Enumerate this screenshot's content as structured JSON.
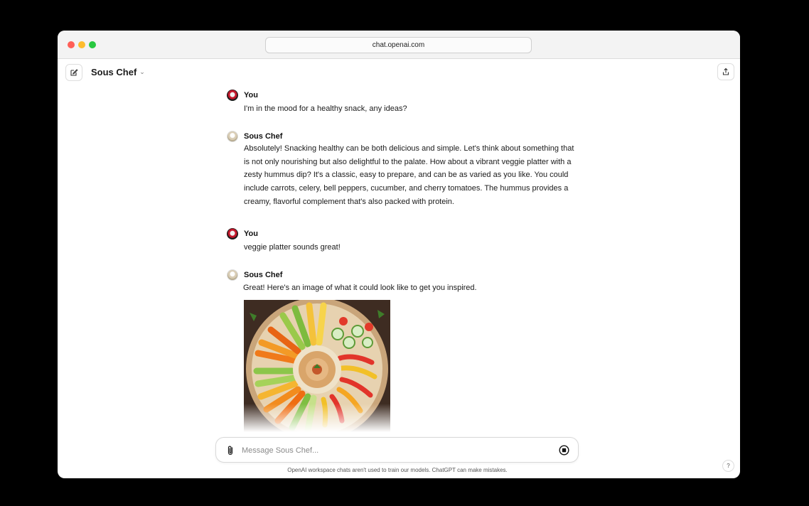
{
  "browser": {
    "url": "chat.openai.com"
  },
  "header": {
    "model_name": "Sous Chef"
  },
  "messages": [
    {
      "author": "You",
      "text": "I'm in the mood for a healthy snack, any ideas?"
    },
    {
      "author": "Sous Chef",
      "text": "Absolutely! Snacking healthy can be both delicious and simple. Let's think about something that is not only nourishing but also delightful to the palate. How about a vibrant veggie platter with a zesty hummus dip? It's a classic, easy to prepare, and can be as varied as you like. You could include carrots, celery, bell peppers, cucumber, and cherry tomatoes. The hummus provides a creamy, flavorful complement that's also packed with protein."
    },
    {
      "author": "You",
      "text": "veggie platter sounds great!"
    },
    {
      "author": "Sous Chef",
      "text": "Great! Here's an image of what it could look like to get you inspired."
    }
  ],
  "composer": {
    "placeholder": "Message Sous Chef..."
  },
  "footer": {
    "disclaimer": "OpenAI workspace chats aren't used to train our models. ChatGPT can make mistakes."
  },
  "help": {
    "label": "?"
  },
  "icons": {
    "new_chat": "edit-icon",
    "share": "share-icon",
    "attach": "paperclip-icon",
    "stop": "stop-icon"
  }
}
